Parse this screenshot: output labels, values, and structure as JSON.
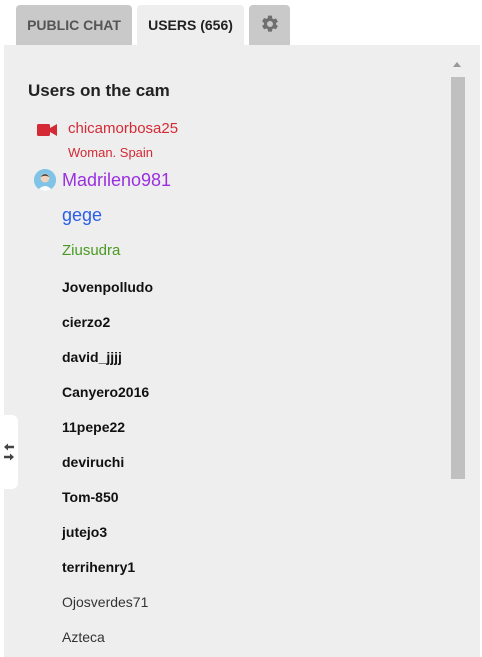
{
  "tabs": {
    "public_chat": "PUBLIC CHAT",
    "users": "USERS (656)",
    "settings_icon": "gear-icon"
  },
  "panel": {
    "title": "Users on the cam"
  },
  "cam_user": {
    "name": "chicamorbosa25",
    "subtitle": "Woman. Spain",
    "icon": "video-camera-icon",
    "color": "#d42a36"
  },
  "users": {
    "featured": [
      {
        "name": "Madrileno981",
        "color": "#9b2fe0"
      },
      {
        "name": "gege",
        "color": "#2a5ee8"
      },
      {
        "name": "Ziusudra",
        "color": "#4a9a22"
      }
    ],
    "list": [
      "Jovenpolludo",
      "cierzo2",
      "david_jjjj",
      "Canyero2016",
      "11pepe22",
      "deviruchi",
      "Tom-850",
      "jutejo3",
      "terrihenry1",
      "Ojosverdes71",
      "Azteca"
    ]
  },
  "side_handle_icon": "swap-arrows-icon"
}
